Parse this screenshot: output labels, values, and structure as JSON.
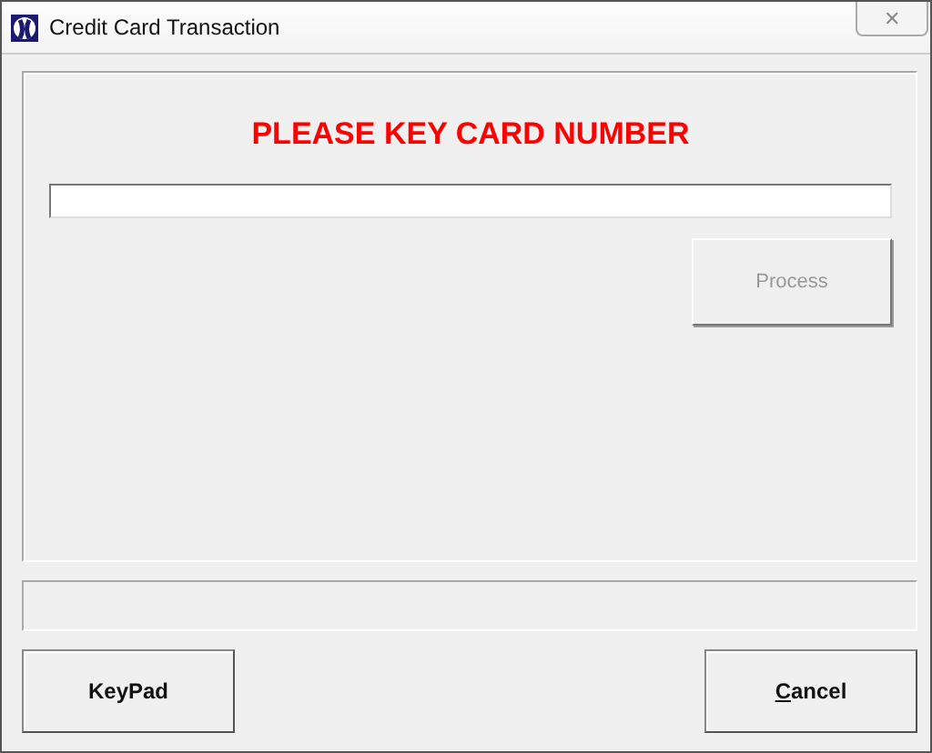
{
  "window": {
    "title": "Credit Card Transaction",
    "close": "✕"
  },
  "prompt": "PLEASE KEY CARD NUMBER",
  "process_button": {
    "label": "Process",
    "disabled": true
  },
  "buttons": [
    {
      "label": "KeyPad",
      "first_letter_underlined": false
    },
    {
      "label": "Cancel",
      "first_letter_underlined": true
    }
  ]
}
